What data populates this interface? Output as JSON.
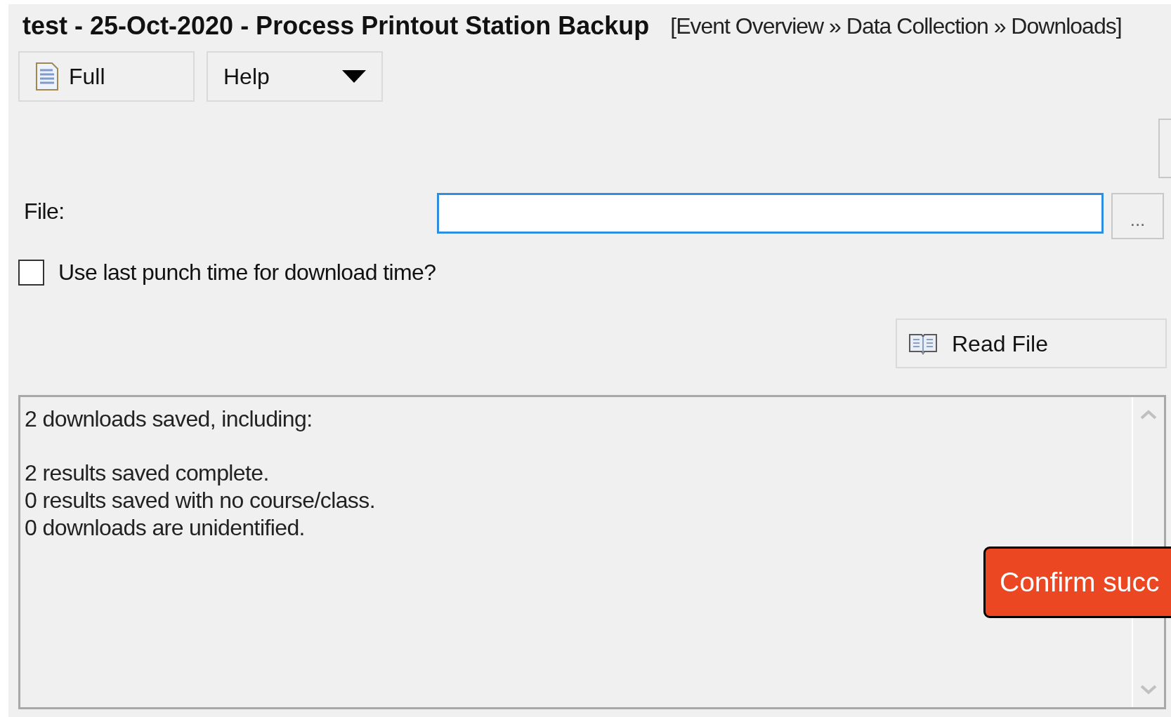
{
  "window": {
    "title": "test - 25-Oct-2020 - Process Printout Station Backup",
    "breadcrumb": "[Event Overview » Data Collection » Downloads]"
  },
  "toolbar": [
    {
      "kind": "icon",
      "label": "Full"
    },
    {
      "kind": "dropdown",
      "label": "Help"
    }
  ],
  "file": {
    "label": "File:",
    "focused": true,
    "browse": "..."
  },
  "checkbox": {
    "label": "Use last punch time for download time?",
    "checked": false
  },
  "read_button": {
    "label": "Read File"
  },
  "log": [
    [
      "2 downloads saved, including:"
    ],
    [
      "2 results saved complete.",
      "0 results saved with no course/class.",
      "0 downloads are unidentified."
    ]
  ],
  "callout": {
    "text": "Confirm succ"
  }
}
